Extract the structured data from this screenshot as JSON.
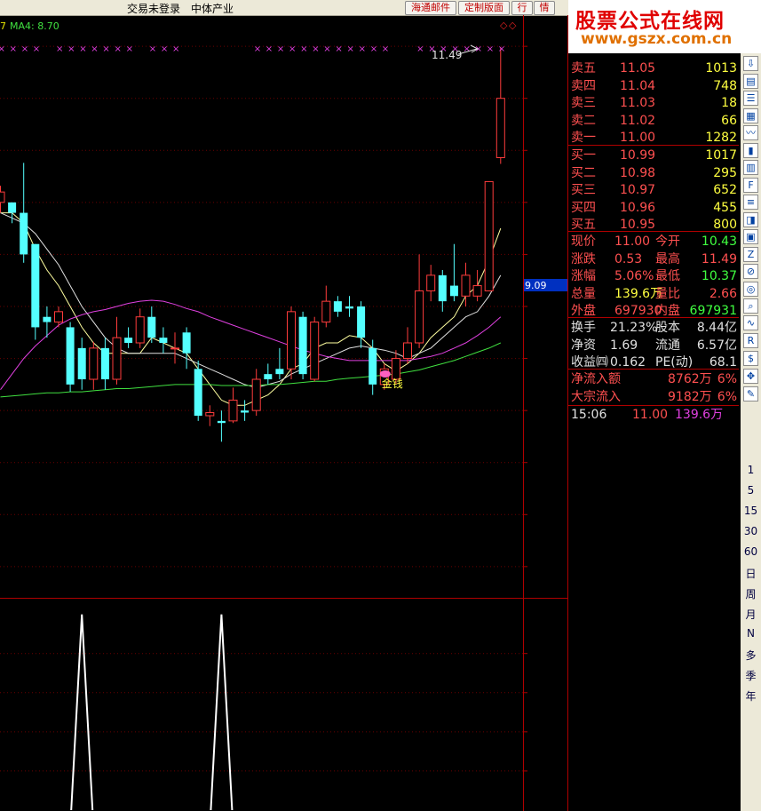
{
  "titlebar": {
    "menu_left": "交易未登录",
    "menu_mid": "中体产业",
    "btn_mail": "海通邮件",
    "btn_custom": "定制版面",
    "btn_quote": "行",
    "btn_info": "情"
  },
  "watermark": {
    "line1": "股票公式在线网",
    "line2": "www.gszx.com.cn"
  },
  "indicator": {
    "left": "7",
    "ma4": "MA4: 8.70"
  },
  "chart_data": {
    "type": "candlestick",
    "price_axis": {
      "ticks": [
        "11.50",
        "11.00",
        "10.50",
        "10.00",
        "9.50",
        "9.00",
        "8.50",
        "8.00",
        "7.50",
        "7.00",
        "6.50"
      ],
      "range": [
        6.2,
        11.8
      ]
    },
    "osc_axis": {
      "ticks": [
        "0.80",
        "0.60",
        "0.40",
        "0.20"
      ],
      "range": [
        0,
        1.08
      ]
    },
    "crosshair_value": "9.09",
    "high_label": "11.49",
    "signal_label": "金钱",
    "candles": [
      [
        10.0,
        10.1,
        10.16,
        9.9
      ],
      [
        10.0,
        9.9,
        10.0,
        9.8
      ],
      [
        9.9,
        9.5,
        10.38,
        9.42
      ],
      [
        9.6,
        8.8,
        9.6,
        8.68
      ],
      [
        8.9,
        8.85,
        9.0,
        8.7
      ],
      [
        8.85,
        8.95,
        9.0,
        8.8
      ],
      [
        8.8,
        8.25,
        8.85,
        8.18
      ],
      [
        8.6,
        8.3,
        8.7,
        8.2
      ],
      [
        8.3,
        8.6,
        8.66,
        8.2
      ],
      [
        8.6,
        8.3,
        8.7,
        8.2
      ],
      [
        8.3,
        8.7,
        8.9,
        8.25
      ],
      [
        8.7,
        8.65,
        8.8,
        8.6
      ],
      [
        8.65,
        8.9,
        8.98,
        8.6
      ],
      [
        8.9,
        8.7,
        9.0,
        8.65
      ],
      [
        8.7,
        8.65,
        8.8,
        8.55
      ],
      [
        8.6,
        8.6,
        8.75,
        8.45
      ],
      [
        8.75,
        8.55,
        8.8,
        8.4
      ],
      [
        8.4,
        7.95,
        8.48,
        7.9
      ],
      [
        7.95,
        7.98,
        8.05,
        7.85
      ],
      [
        7.9,
        7.88,
        8.0,
        7.7
      ],
      [
        7.9,
        8.1,
        8.22,
        7.88
      ],
      [
        8.0,
        7.98,
        8.1,
        7.9
      ],
      [
        8.0,
        8.3,
        8.4,
        7.95
      ],
      [
        8.35,
        8.3,
        8.45,
        8.25
      ],
      [
        8.4,
        8.35,
        8.6,
        8.3
      ],
      [
        8.4,
        8.95,
        9.0,
        8.3
      ],
      [
        8.9,
        8.35,
        8.95,
        8.3
      ],
      [
        8.3,
        8.85,
        8.9,
        8.28
      ],
      [
        8.85,
        9.05,
        9.2,
        8.8
      ],
      [
        9.05,
        8.95,
        9.1,
        8.9
      ],
      [
        9.0,
        8.98,
        9.1,
        8.9
      ],
      [
        9.0,
        8.7,
        9.05,
        8.6
      ],
      [
        8.6,
        8.25,
        8.68,
        8.15
      ],
      [
        8.25,
        8.4,
        8.45,
        8.2
      ],
      [
        8.3,
        8.5,
        8.58,
        8.25
      ],
      [
        8.5,
        8.65,
        8.8,
        8.45
      ],
      [
        8.65,
        9.15,
        9.5,
        8.6
      ],
      [
        9.15,
        9.3,
        9.4,
        9.05
      ],
      [
        9.3,
        9.05,
        9.35,
        8.95
      ],
      [
        9.2,
        9.1,
        9.6,
        9.05
      ],
      [
        9.1,
        9.3,
        9.42,
        9.0
      ],
      [
        9.1,
        9.2,
        9.35,
        9.05
      ],
      [
        9.15,
        10.2,
        10.2,
        9.15
      ],
      [
        10.43,
        11.0,
        11.49,
        10.37
      ]
    ],
    "ma_lines": [
      {
        "name": "MA5",
        "color": "#ffffa0",
        "values": [
          9.9,
          9.9,
          9.8,
          9.55,
          9.35,
          9.2,
          9.0,
          8.8,
          8.65,
          8.55,
          8.55,
          8.55,
          8.55,
          8.7,
          8.65,
          8.6,
          8.55,
          8.4,
          8.25,
          8.1,
          8.05,
          8.05,
          8.1,
          8.15,
          8.25,
          8.4,
          8.45,
          8.6,
          8.65,
          8.65,
          8.72,
          8.7,
          8.6,
          8.45,
          8.38,
          8.45,
          8.55,
          8.7,
          8.8,
          8.9,
          9.1,
          9.2,
          9.45,
          9.75
        ]
      },
      {
        "name": "MA10",
        "color": "#e0e0e0",
        "values": [
          9.9,
          9.85,
          9.8,
          9.7,
          9.55,
          9.4,
          9.2,
          9.0,
          8.85,
          8.7,
          8.6,
          8.55,
          8.55,
          8.55,
          8.55,
          8.55,
          8.5,
          8.45,
          8.4,
          8.35,
          8.3,
          8.25,
          8.22,
          8.25,
          8.28,
          8.35,
          8.4,
          8.45,
          8.5,
          8.55,
          8.6,
          8.62,
          8.6,
          8.58,
          8.55,
          8.5,
          8.55,
          8.6,
          8.7,
          8.8,
          8.9,
          8.95,
          9.1,
          9.3
        ]
      },
      {
        "name": "MA20",
        "color": "#e040e0",
        "values": [
          8.2,
          8.35,
          8.5,
          8.62,
          8.72,
          8.82,
          8.88,
          8.92,
          8.95,
          8.97,
          9.0,
          9.03,
          9.05,
          9.06,
          9.05,
          9.02,
          8.98,
          8.95,
          8.9,
          8.86,
          8.82,
          8.78,
          8.74,
          8.7,
          8.66,
          8.62,
          8.58,
          8.55,
          8.52,
          8.5,
          8.48,
          8.48,
          8.48,
          8.48,
          8.48,
          8.48,
          8.5,
          8.52,
          8.55,
          8.6,
          8.65,
          8.72,
          8.8,
          8.9
        ]
      },
      {
        "name": "MA60",
        "color": "#40e040",
        "values": [
          8.13,
          8.14,
          8.15,
          8.16,
          8.17,
          8.17,
          8.18,
          8.18,
          8.19,
          8.2,
          8.21,
          8.21,
          8.22,
          8.23,
          8.24,
          8.25,
          8.25,
          8.25,
          8.25,
          8.24,
          8.24,
          8.24,
          8.24,
          8.25,
          8.25,
          8.26,
          8.27,
          8.28,
          8.28,
          8.3,
          8.31,
          8.32,
          8.33,
          8.34,
          8.35,
          8.37,
          8.39,
          8.42,
          8.45,
          8.48,
          8.52,
          8.56,
          8.6,
          8.65
        ]
      }
    ],
    "top_markers": [
      0,
      1,
      2,
      3,
      5,
      6,
      7,
      8,
      9,
      10,
      11,
      13,
      14,
      15,
      22,
      23,
      24,
      25,
      26,
      27,
      28,
      29,
      30,
      31,
      32,
      33,
      36,
      37,
      38,
      39,
      40,
      41,
      42,
      43
    ],
    "signal_index": 33,
    "oscillator": {
      "peaks": [
        7,
        19
      ],
      "value": 1
    }
  },
  "quote": {
    "sell": [
      {
        "label": "卖五",
        "price": "11.05",
        "vol": "1013"
      },
      {
        "label": "卖四",
        "price": "11.04",
        "vol": "748"
      },
      {
        "label": "卖三",
        "price": "11.03",
        "vol": "18"
      },
      {
        "label": "卖二",
        "price": "11.02",
        "vol": "66"
      },
      {
        "label": "卖一",
        "price": "11.00",
        "vol": "1282"
      }
    ],
    "buy": [
      {
        "label": "买一",
        "price": "10.99",
        "vol": "1017"
      },
      {
        "label": "买二",
        "price": "10.98",
        "vol": "295"
      },
      {
        "label": "买三",
        "price": "10.97",
        "vol": "652"
      },
      {
        "label": "买四",
        "price": "10.96",
        "vol": "455"
      },
      {
        "label": "买五",
        "price": "10.95",
        "vol": "800"
      }
    ],
    "stats": [
      {
        "l1": "现价",
        "v1": "11.00",
        "c1": "#ff5050",
        "l2": "今开",
        "v2": "10.43",
        "c2": "#40ff40"
      },
      {
        "l1": "涨跌",
        "v1": "0.53",
        "c1": "#ff5050",
        "l2": "最高",
        "v2": "11.49",
        "c2": "#ff5050"
      },
      {
        "l1": "涨幅",
        "v1": "5.06%",
        "c1": "#ff5050",
        "l2": "最低",
        "v2": "10.37",
        "c2": "#40ff40"
      },
      {
        "l1": "总量",
        "v1": "139.6万",
        "c1": "#ffff40",
        "l2": "量比",
        "v2": "2.66",
        "c2": "#ff5050"
      },
      {
        "l1": "外盘",
        "v1": "697930",
        "c1": "#ff5050",
        "l2": "内盘",
        "v2": "697931",
        "c2": "#40ff40"
      }
    ],
    "fund": [
      {
        "l1": "换手",
        "v1": "21.23%",
        "l2": "股本",
        "v2": "8.44亿"
      },
      {
        "l1": "净资",
        "v1": "1.69",
        "l2": "流通",
        "v2": "6.57亿"
      },
      {
        "l1": "收益㈣",
        "v1": "0.162",
        "l2": "PE(动)",
        "v2": "68.1"
      }
    ],
    "flow": [
      {
        "l": "净流入额",
        "v": "8762万",
        "p": "6%"
      },
      {
        "l": "大宗流入",
        "v": "9182万",
        "p": "6%"
      }
    ],
    "tick": {
      "time": "15:06",
      "price": "11.00",
      "vol": "139.6万"
    }
  },
  "toolbar": {
    "icons": [
      "arrow-down-icon",
      "doc-icon",
      "list-icon",
      "doc2-icon",
      "line-chart-icon",
      "candle-icon",
      "grid-icon",
      "fin-icon",
      "book-icon",
      "f10-icon",
      "info-icon",
      "fiz-icon",
      "f5-icon",
      "compass-icon",
      "search-icon"
    ],
    "icons2": [
      "wave-icon",
      "rsi-icon",
      "dollar-icon",
      "move-icon",
      "pen-icon"
    ],
    "periods": [
      "1",
      "5",
      "15",
      "30",
      "60",
      "日",
      "周",
      "月",
      "N",
      "多",
      "季",
      "年"
    ]
  }
}
